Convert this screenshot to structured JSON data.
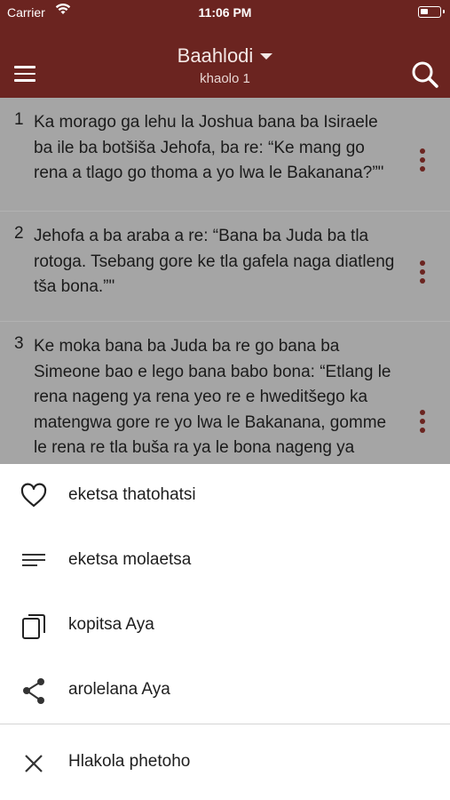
{
  "status_bar": {
    "carrier": "Carrier",
    "time": "11:06 PM"
  },
  "header": {
    "title": "Baahlodi",
    "subtitle": "khaolo 1"
  },
  "verses": [
    {
      "number": "1",
      "text": "Ka morago ga lehu la Joshua bana ba Isiraele ba ile ba botšiša Jehofa, ba re: “Ke mang go rena a tlago go thoma a yo lwa le Bakanana?”\""
    },
    {
      "number": "2",
      "text": "Jehofa a ba araba a re: “Bana ba Juda ba tla rotoga. Tsebang gore ke tla gafela naga diatleng tša bona.”\""
    },
    {
      "number": "3",
      "text": "Ke moka bana ba Juda ba re go bana ba Simeone bao e lego bana babo bona: “Etlang le rena nageng ya rena yeo re e hweditšego ka matengwa gore re yo lwa le Bakanana, gomme le rena re tla buša ra ya le bona nageng ya bona.” Bana ba Simeone ba ya le bona."
    }
  ],
  "action_sheet": {
    "favorite_label": "eketsa thatohatsi",
    "note_label": "eketsa molaetsa",
    "copy_label": "kopitsa Aya",
    "share_label": "arolelana Aya",
    "cancel_label": "Hlakola phetoho"
  },
  "colors": {
    "brand": "#6b2420",
    "overlay": "#a5a5a5"
  },
  "icons": [
    "menu-icon",
    "search-icon",
    "dropdown-caret-icon",
    "more-vertical-icon",
    "heart-icon",
    "lines-icon",
    "copy-icon",
    "share-icon",
    "close-icon"
  ]
}
